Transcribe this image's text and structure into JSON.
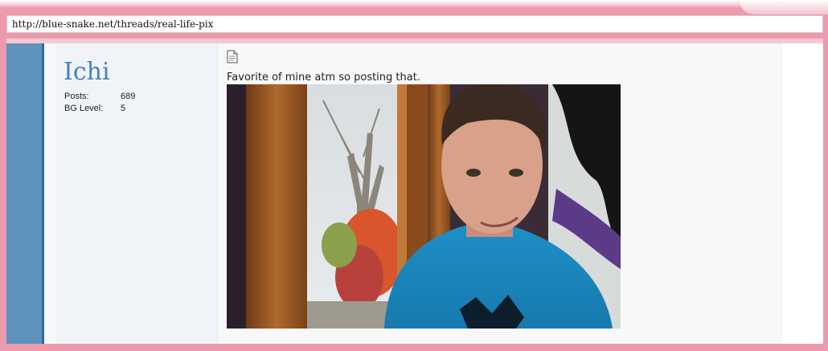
{
  "browser": {
    "url": "http://blue-snake.net/threads/real-life-pix"
  },
  "user": {
    "name": "Ichi",
    "stats": [
      {
        "label": "Posts:",
        "value": "689"
      },
      {
        "label": "BG Level:",
        "value": "5"
      }
    ]
  },
  "post": {
    "icon": "document-icon",
    "text": "Favorite of mine atm so posting that."
  },
  "colors": {
    "frame": "#ee9aae",
    "sidebar_blue": "#5f92bd",
    "username": "#4a80b7",
    "shirt": "#1e8fc6"
  }
}
